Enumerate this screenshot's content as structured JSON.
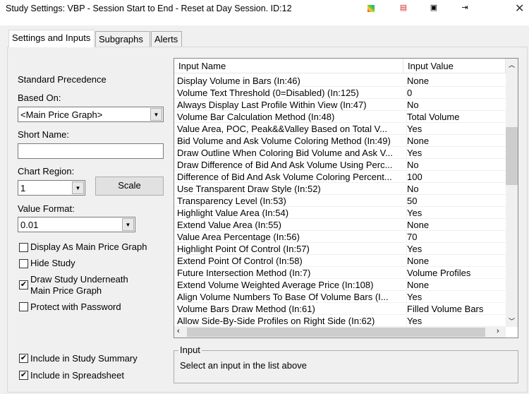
{
  "window": {
    "title": "Study Settings: VBP - Session Start to End - Reset at Day Session. ID:12",
    "icons": [
      "color-icon",
      "pdf-icon",
      "layout-icon",
      "pin-icon",
      "close-icon"
    ],
    "close_glyph": "✕"
  },
  "tabs": [
    {
      "label": "Settings and Inputs",
      "active": true
    },
    {
      "label": "Subgraphs"
    },
    {
      "label": "Alerts"
    }
  ],
  "left": {
    "precedence": "Standard Precedence",
    "based_on_label": "Based On:",
    "based_on_value": "<Main Price Graph>",
    "short_name_label": "Short Name:",
    "short_name_value": "",
    "chart_region_label": "Chart Region:",
    "chart_region_value": "1",
    "scale_label": "Scale",
    "value_format_label": "Value Format:",
    "value_format_value": "0.01",
    "checkboxes": [
      {
        "label": "Display As Main Price Graph",
        "checked": false
      },
      {
        "label": "Hide Study",
        "checked": false
      },
      {
        "label": "Draw Study Underneath",
        "label2": "Main Price Graph",
        "checked": true
      },
      {
        "label": "Protect with Password",
        "checked": false
      },
      {
        "label": "Include in Study Summary",
        "checked": true
      },
      {
        "label": "Include in Spreadsheet",
        "checked": true
      }
    ]
  },
  "table": {
    "headers": [
      "Input Name",
      "Input Value"
    ],
    "rows": [
      [
        "Display Volume in Bars   (In:46)",
        "None"
      ],
      [
        "Volume Text Threshold (0=Disabled)   (In:125)",
        "0"
      ],
      [
        "Always Display Last Profile Within View   (In:47)",
        "No"
      ],
      [
        "Volume Bar Calculation Method   (In:48)",
        "Total Volume"
      ],
      [
        "Value Area, POC, Peak&&Valley Based on Total V...",
        "Yes"
      ],
      [
        "Bid Volume and Ask Volume Coloring Method   (In:49)",
        "None"
      ],
      [
        "Draw Outline When Coloring Bid Volume and Ask V...",
        "Yes"
      ],
      [
        "Draw Difference of Bid And Ask Volume Using Perc...",
        "No"
      ],
      [
        "Difference of Bid And Ask Volume Coloring Percent...",
        "100"
      ],
      [
        "Use Transparent Draw Style   (In:52)",
        "No"
      ],
      [
        "Transparency Level   (In:53)",
        "50"
      ],
      [
        "Highlight Value Area   (In:54)",
        "Yes"
      ],
      [
        "Extend Value Area   (In:55)",
        "None"
      ],
      [
        "Value Area Percentage   (In:56)",
        "70"
      ],
      [
        "Highlight Point Of Control   (In:57)",
        "Yes"
      ],
      [
        "Extend Point Of Control   (In:58)",
        "None"
      ],
      [
        "Future Intersection Method   (In:7)",
        "Volume Profiles"
      ],
      [
        "Extend Volume Weighted Average Price   (In:108)",
        "None"
      ],
      [
        "Align Volume Numbers To Base Of Volume Bars   (I...",
        "Yes"
      ],
      [
        "Volume Bars Draw Method   (In:61)",
        "Filled Volume Bars"
      ],
      [
        "Allow Side-By-Side Profiles on Right Side   (In:62)",
        "Yes"
      ]
    ]
  },
  "input_group": {
    "title": "Input",
    "text": "Select an input in the list above"
  }
}
